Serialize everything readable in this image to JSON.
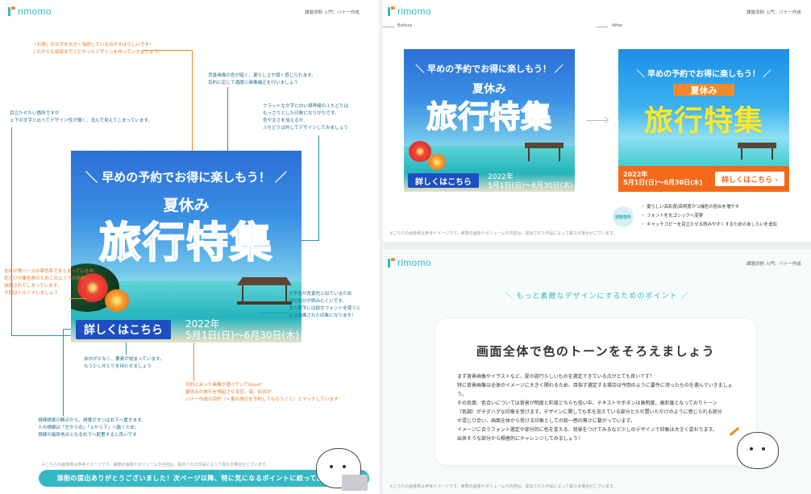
{
  "logo": "rimomo",
  "header_right": "課題添削 入門：バナー作成",
  "left": {
    "notes": [
      "「お得」の文字を大きく強調している点がすばらしいです！",
      "これからも細部までこだわったデザインを作っていきましょう。",
      "背景画像の色が暗く、夏らしさが弱く感じられます。",
      "目的に応じて適度に画像補正を行いましょう",
      "フラットな文字に白い境界線のふちどりは",
      "もっさりとした印象になりがちです。",
      "色や太さを加えるか、",
      "ふちどりは外してデザインしてみましょう",
      "目立たせたい箇所ですが",
      "上下の文字と比べてデザイン性が薄く、沈んで見えてしまっています。",
      "全体が青ベースの寒色系でまとまっている中、",
      "花だけが暖色系のためこのエリアが過剰に",
      "強調されてしまっています。",
      "今回はトルツメしましょう",
      "文字色が背景色と似ているため",
      "日付部分が読みにくいです。",
      "また数字には欧文フォントを使うと",
      "より洗練された印象になります！",
      "余白が少なく、要素が詰まっています。",
      "もう少しゆとりを持たせましょう",
      "目的に合った画像が選べていてGood！",
      "夏休みの旅行を想起させる空、海、砂浜が",
      "バナー作成の目的（＝夏の旅行を予約してもらうこと）とマッチしています",
      "視線誘導の観点から、誘導ボタンは右下へ置きます。",
      "人の視線は「左から右」「上から下」へ動くため、",
      "視線の最終地点となる右下へ配置すると良いです"
    ],
    "footnote": "※こちらの画像例は参考イメージです。実際の画像やボリュームや内容は、提出された作品によって異なる場合がございます。",
    "cta": "添削の提出ありがとうございました！次ページ以降、特に気になるポイントに絞って解説します"
  },
  "banner": {
    "tagline": "＼ 早めの予約でお得に楽しもう！ ／",
    "sub": "夏休み",
    "title": "旅行特集",
    "button": "詳しくはこちら",
    "button_after": "詳しくはこちら ›",
    "year": "2022年",
    "dates": "5月1日(日)～6月30日(木)"
  },
  "tr": {
    "before": "Before",
    "after": "After",
    "badge": "調整箇所",
    "points": [
      "・ 夏らしい高彩度/高明度かつ補色の割合を増やす",
      "・ フォントを丸ゴシックへ変更",
      "・ キャッチコピーを目立たせる読みやすくするためのあしらいを追加"
    ],
    "footnote": "※こちらの画像例は参考イメージです。実際の画像やボリュームや内容は、提出された作品によって異なる場合がございます。"
  },
  "br": {
    "heading": "＼ もっと素敵なデザインにするためのポイント ／",
    "card_title": "画面全体で色のトーンをそろえましょう",
    "card_lines": [
      "まず背景画像やイラストなど、夏の旅行らしいものを選定できている点がとても良いです！",
      "特に背景画像は全体のイメージに大きく関わるため、目指す選定する場合は今回のように要件に添ったものを選んでいきましょう。",
      "",
      "その反面、色合いについては背景が明度と彩度どちらも低い中、テキストやボタンは高明度、高彩度となっておりトーン",
      "（色調）がチグハグな印象を受けます。デザインに関しても手を加えている部分とただ置いただけのように感じられる部分",
      "が混じり合い、画面全体から受ける印象としての統一感の無さに繋がっています。",
      "イメージに合うフォント選定や部分的に色を変える、背景をつけてみるなど少しのデザインで印象は大きく変わります。",
      "出来そうな部分から積極的にチャレンジしてみましょう！"
    ],
    "footnote": "※こちらの画像例は参考イメージです。実際の画像やボリュームや内容は、提出された作品によって異なる場合がございます。"
  },
  "colors": {
    "accent": "#37b9c4",
    "orange": "#f08a2c",
    "blue_note": "#1e6f8f"
  }
}
